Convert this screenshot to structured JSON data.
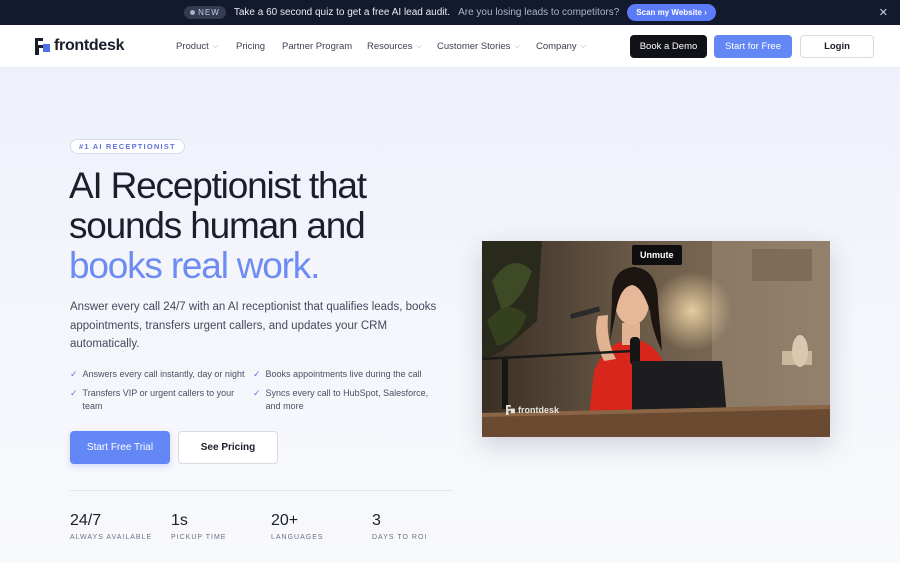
{
  "announcement": {
    "badge": "NEW",
    "text": "Take a 60 second quiz to get a free AI lead audit.",
    "muted_text": "Are you losing leads to competitors?",
    "cta": "Scan my Website",
    "close_icon": "close-icon"
  },
  "nav": {
    "logo": "frontdesk",
    "items": [
      {
        "label": "Product",
        "dropdown": true
      },
      {
        "label": "Pricing",
        "dropdown": false
      },
      {
        "label": "Partner Program",
        "dropdown": false
      },
      {
        "label": "Resources",
        "dropdown": true
      },
      {
        "label": "Customer Stories",
        "dropdown": true
      },
      {
        "label": "Company",
        "dropdown": true
      }
    ],
    "book_demo": "Book a Demo",
    "start_free": "Start for Free",
    "login": "Login"
  },
  "hero": {
    "tag": "#1 AI RECEPTIONIST",
    "title_line1": "AI Receptionist that",
    "title_line2": "sounds human and",
    "title_line3": "books real work.",
    "lead": "Answer every call 24/7 with an AI receptionist that qualifies leads, books appointments, transfers urgent callers, and updates your CRM automatically.",
    "features": [
      "Answers every call instantly, day or night",
      "Books appointments live during the call",
      "Transfers VIP or urgent callers to your team",
      "Syncs every call to HubSpot, Salesforce, and more"
    ],
    "primary_cta": "Start Free Trial",
    "secondary_cta": "See Pricing",
    "stats": [
      {
        "value": "24/7",
        "label": "ALWAYS AVAILABLE"
      },
      {
        "value": "1s",
        "label": "PICKUP TIME"
      },
      {
        "value": "20+",
        "label": "LANGUAGES"
      },
      {
        "value": "3",
        "label": "DAYS TO ROI"
      }
    ]
  },
  "video": {
    "unmute": "Unmute",
    "watermark": "frontdesk"
  },
  "colors": {
    "accent": "#6487f6",
    "dark": "#101218",
    "headline_blue": "#6d8cf3"
  }
}
